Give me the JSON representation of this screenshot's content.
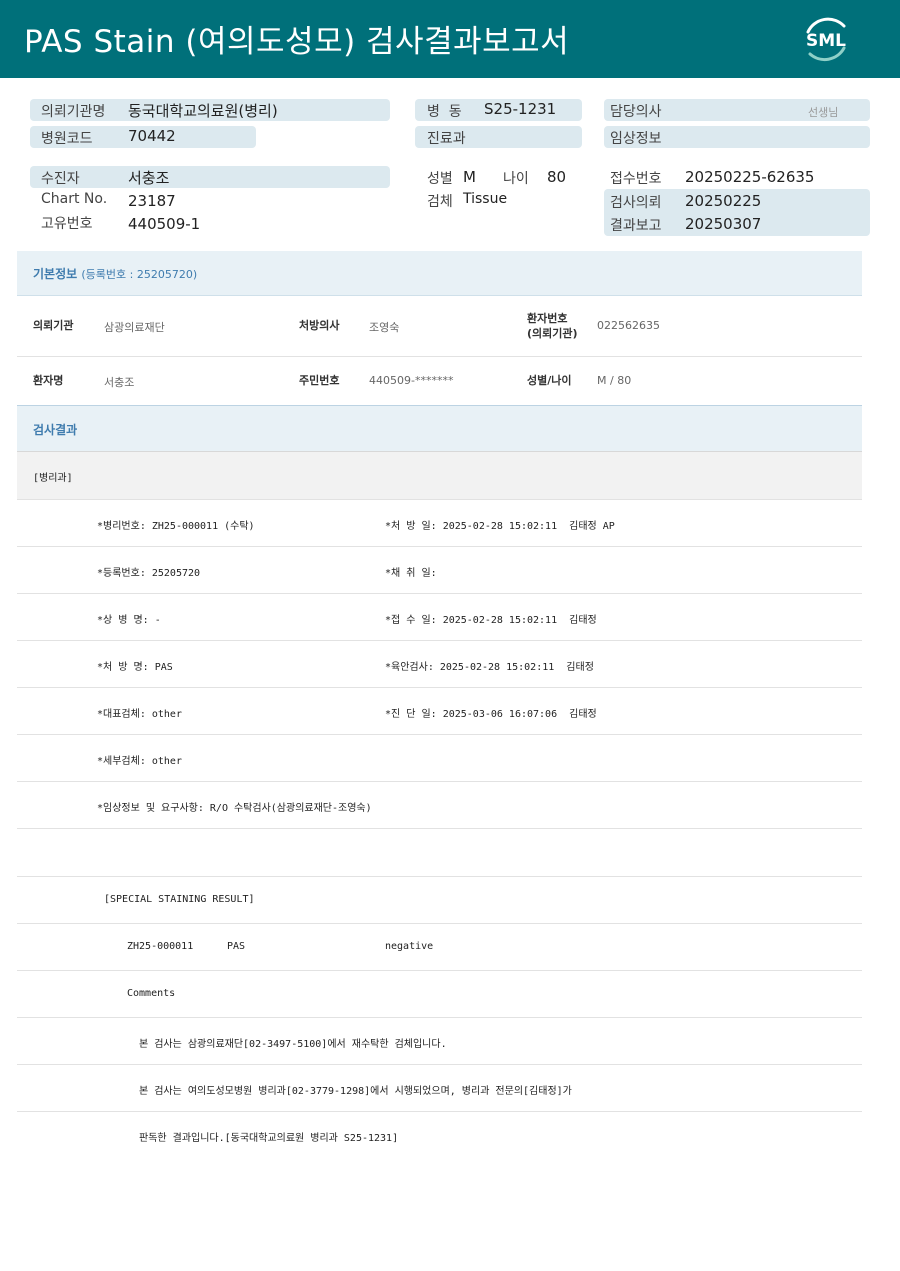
{
  "header": {
    "title": "PAS Stain (여의도성모) 검사결과보고서",
    "logo_text": "SML",
    "color": "#00707a"
  },
  "summary": {
    "institution_label": "의뢰기관명",
    "institution_value": "동국대학교의료원(병리)",
    "hospital_code_label": "병원코드",
    "hospital_code_value": "70442",
    "ward_label": "병  동",
    "ward_value": "S25-1231",
    "department_label": "진료과",
    "department_value": "",
    "doctor_label": "담당의사",
    "doctor_suffix": "선생님",
    "clinical_info_label": "임상정보",
    "clinical_info_value": "",
    "patient_label": "수진자",
    "patient_value": "서충조",
    "chart_label": "Chart No.",
    "chart_value": "23187",
    "unique_label": "고유번호",
    "unique_value": "440509-1",
    "sex_label": "성별",
    "sex_value": "M",
    "age_label": "나이",
    "age_value": "80",
    "specimen_label": "검체",
    "specimen_value": "Tissue",
    "receipt_label": "접수번호",
    "receipt_value": "20250225-62635",
    "request_label": "검사의뢰",
    "request_value": "20250225",
    "report_label": "결과보고",
    "report_value": "20250307"
  },
  "basic_info": {
    "title": "기본정보",
    "reg_note": "(등록번호 : 25205720)",
    "row1": {
      "institution_key": "의뢰기관",
      "institution_val": "삼광의료재단",
      "prescriber_key": "처방의사",
      "prescriber_val": "조영숙",
      "patient_no_key_1": "환자번호",
      "patient_no_key_2": "(의뢰기관)",
      "patient_no_val": "022562635"
    },
    "row2": {
      "name_key": "환자명",
      "name_val": "서충조",
      "rrn_key": "주민번호",
      "rrn_val": "440509-*******",
      "sex_age_key": "성별/나이",
      "sex_age_val": "M / 80"
    }
  },
  "results": {
    "title": "검사결과",
    "dept": "[병리과]",
    "rows": [
      {
        "left": "*병리번호: ZH25-000011 (수탁)",
        "right": "*처 방 일: 2025-02-28 15:02:11  김태정 AP"
      },
      {
        "left": "*등록번호: 25205720",
        "right": "*채 취 일:"
      },
      {
        "left": "*상 병 명: -",
        "right": "*접 수 일: 2025-02-28 15:02:11  김태정"
      },
      {
        "left": "*처 방 명: PAS",
        "right": "*육안검사: 2025-02-28 15:02:11  김태정"
      },
      {
        "left": "*대표검체: other",
        "right": "*진 단 일: 2025-03-06 16:07:06  김태정"
      },
      {
        "left": "*세부검체: other",
        "right": ""
      },
      {
        "left": "*임상정보 및 요구사항: R/O 수탁검사(삼광의료재단-조영숙)",
        "right": ""
      }
    ],
    "special_title": "[SPECIAL STAINING RESULT]",
    "stain_no": "ZH25-000011",
    "stain_name": "PAS",
    "stain_result": "negative",
    "comments_label": "Comments",
    "comment_lines": [
      "본 검사는 삼광의료재단[02-3497-5100]에서 재수탁한 검체입니다.",
      "본 검사는 여의도성모병원 병리과[02-3779-1298]에서 시행되었으며, 병리과 전문의[김태정]가",
      "판독한 결과입니다.[동국대학교의료원 병리과 S25-1231]"
    ]
  }
}
